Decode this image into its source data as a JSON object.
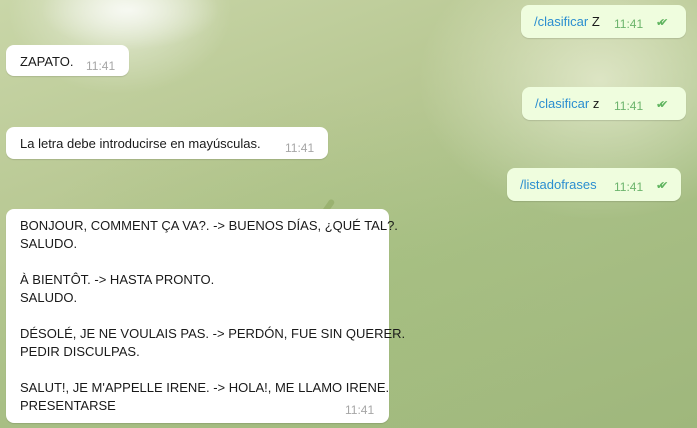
{
  "messages": [
    {
      "dir": "out",
      "command": "/clasificar",
      "arg": "Z",
      "time": "11:41",
      "status": "read"
    },
    {
      "dir": "in",
      "text": "ZAPATO.",
      "time": "11:41"
    },
    {
      "dir": "out",
      "command": "/clasificar",
      "arg": "z",
      "time": "11:41",
      "status": "read"
    },
    {
      "dir": "in",
      "text": "La letra debe introducirse en mayúsculas.",
      "time": "11:41"
    },
    {
      "dir": "out",
      "command": "/listadofrases",
      "arg": "",
      "time": "11:41",
      "status": "read"
    },
    {
      "dir": "in",
      "time": "11:41",
      "lines": [
        "BONJOUR, COMMENT ÇA VA?. -> BUENOS DÍAS, ¿QUÉ TAL?.",
        "SALUDO.",
        "À BIENTÔT. -> HASTA PRONTO.",
        "SALUDO.",
        "DÉSOLÉ, JE NE VOULAIS PAS. -> PERDÓN, FUE SIN QUERER.",
        "PEDIR DISCULPAS.",
        "SALUT!, JE M'APPELLE IRENE. -> HOLA!, ME LLAMO IRENE.",
        "PRESENTARSE"
      ]
    }
  ],
  "icons": {
    "read_receipt": "double-check-icon"
  }
}
